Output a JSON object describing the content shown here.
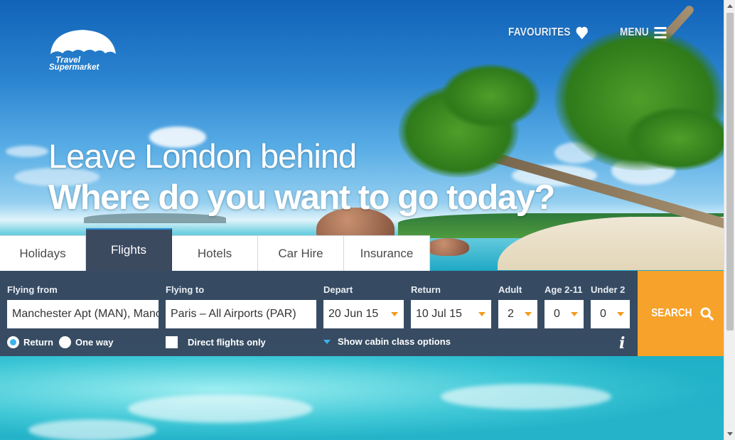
{
  "brand": {
    "logo_line1": "Travel",
    "logo_line2": "Supermarket"
  },
  "nav": {
    "favourites_label": "FAVOURITES",
    "menu_label": "MENU"
  },
  "hero": {
    "line1": "Leave London behind",
    "line2": "Where do you want to go today?"
  },
  "tabs": [
    {
      "label": "Holidays"
    },
    {
      "label": "Flights",
      "active": true
    },
    {
      "label": "Hotels"
    },
    {
      "label": "Car Hire"
    },
    {
      "label": "Insurance"
    }
  ],
  "search": {
    "flying_from": {
      "label": "Flying from",
      "value": "Manchester Apt (MAN), Manchester"
    },
    "flying_to": {
      "label": "Flying to",
      "value": "Paris – All Airports (PAR)"
    },
    "depart": {
      "label": "Depart",
      "value": "20 Jun 15"
    },
    "return": {
      "label": "Return",
      "value": "10 Jul 15"
    },
    "adult": {
      "label": "Adult",
      "value": "2"
    },
    "age_2_11": {
      "label": "Age 2-11",
      "value": "0"
    },
    "under_2": {
      "label": "Under 2",
      "value": "0"
    },
    "trip_return_label": "Return",
    "trip_oneway_label": "One way",
    "direct_only_label": "Direct flights only",
    "cabin_options_label": "Show cabin class options",
    "info_glyph": "i",
    "search_label": "SEARCH"
  },
  "colors": {
    "accent": "#f7a22a",
    "panel": "#38445a",
    "radio_active": "#3cb2ee"
  }
}
